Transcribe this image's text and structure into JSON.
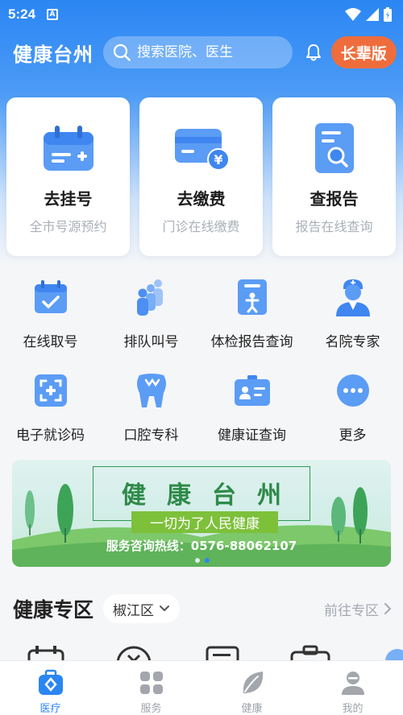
{
  "status": {
    "time": "5:24",
    "notif": "A"
  },
  "header": {
    "title": "健康台州",
    "search_placeholder": "搜索医院、医生",
    "elder_mode": "长辈版"
  },
  "big_cards": [
    {
      "title": "去挂号",
      "sub": "全市号源预约",
      "icon": "calendar-add-icon"
    },
    {
      "title": "去缴费",
      "sub": "门诊在线缴费",
      "icon": "payment-card-icon"
    },
    {
      "title": "查报告",
      "sub": "报告在线查询",
      "icon": "report-search-icon"
    }
  ],
  "grid": [
    {
      "label": "在线取号",
      "icon": "calendar-check-icon"
    },
    {
      "label": "排队叫号",
      "icon": "queue-people-icon"
    },
    {
      "label": "体检报告查询",
      "icon": "checkup-report-icon"
    },
    {
      "label": "名院专家",
      "icon": "doctor-icon"
    },
    {
      "label": "电子就诊码",
      "icon": "qr-scan-icon"
    },
    {
      "label": "口腔专科",
      "icon": "tooth-icon"
    },
    {
      "label": "健康证查询",
      "icon": "health-id-icon"
    },
    {
      "label": "更多",
      "icon": "more-icon"
    }
  ],
  "banner": {
    "title": "健康台州",
    "slogan": "一切为了人民健康",
    "hotline": "服务咨询热线：0576-88062107"
  },
  "zone": {
    "title": "健康专区",
    "district": "椒江区",
    "link": "前往专区"
  },
  "tabs": [
    {
      "label": "医疗",
      "icon": "medical-bag-icon",
      "active": true
    },
    {
      "label": "服务",
      "icon": "service-grid-icon",
      "active": false
    },
    {
      "label": "健康",
      "icon": "leaf-icon",
      "active": false
    },
    {
      "label": "我的",
      "icon": "user-icon",
      "active": false
    }
  ],
  "colors": {
    "primary": "#2b86f3",
    "elder": "#ef6d3c",
    "banner_green": "#2e8a48"
  }
}
